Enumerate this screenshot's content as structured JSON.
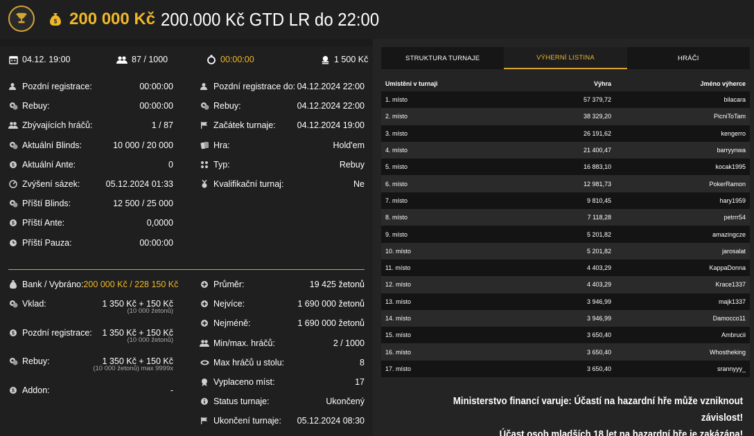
{
  "header": {
    "amount": "200 000 Kč",
    "title": "200.000 Kč GTD LR do 22:00"
  },
  "top_info": {
    "date": "04.12. 19:00",
    "players": "87 / 1000",
    "timer": "00:00:00",
    "buyin": "1 500 Kč"
  },
  "left_col": [
    {
      "icon": "user-clock-icon",
      "label": "Pozdní registrace:",
      "value": "00:00:00"
    },
    {
      "icon": "chips-icon",
      "label": "Rebuy:",
      "value": "00:00:00"
    },
    {
      "icon": "users-icon",
      "label": "Zbývajících hráčů:",
      "value": "1 / 87"
    },
    {
      "icon": "chips-icon",
      "label": "Aktuální Blinds:",
      "value": "10 000 / 20 000"
    },
    {
      "icon": "coin-icon",
      "label": "Aktuální Ante:",
      "value": "0"
    },
    {
      "icon": "gauge-icon",
      "label": "Zvýšení sázek:",
      "value": "05.12.2024 01:33"
    },
    {
      "icon": "chips-icon",
      "label": "Příští Blinds:",
      "value": "12 500 / 25 000"
    },
    {
      "icon": "coin-icon",
      "label": "Příští Ante:",
      "value": "0,0000"
    },
    {
      "icon": "clock-icon",
      "label": "Příští Pauza:",
      "value": "00:00:00"
    }
  ],
  "right_col": [
    {
      "icon": "user-clock-icon",
      "label": "Pozdní registrace do:",
      "value": "04.12.2024 22:00"
    },
    {
      "icon": "chips-icon",
      "label": "Rebuy:",
      "value": "04.12.2024 22:00"
    },
    {
      "icon": "flag-icon",
      "label": "Začátek turnaje:",
      "value": "04.12.2024 19:00"
    },
    {
      "icon": "cards-icon",
      "label": "Hra:",
      "value": "Hold'em"
    },
    {
      "icon": "suits-icon",
      "label": "Typ:",
      "value": "Rebuy"
    },
    {
      "icon": "medal-icon",
      "label": "Kvalifikační turnaj:",
      "value": "Ne"
    }
  ],
  "bank": {
    "label": "Bank / Vybráno:",
    "value": "200 000 Kč / 228 150 Kč"
  },
  "lower_left": [
    {
      "icon": "chips-icon",
      "label": "Vklad:",
      "value": "1 350 Kč + 150 Kč",
      "sub": "(10 000 žetonů)"
    },
    {
      "icon": "coin-icon",
      "label": "Pozdní registrace:",
      "value": "1 350 Kč + 150 Kč",
      "sub": "(10 000 žetonů)"
    },
    {
      "icon": "chips-icon",
      "label": "Rebuy:",
      "value": "1 350 Kč + 150 Kč",
      "sub": "(10 000 žetonů) max 9999x"
    },
    {
      "icon": "coin-icon",
      "label": "Addon:",
      "value": "-",
      "sub": ""
    }
  ],
  "lower_right": [
    {
      "icon": "plus-circle-icon",
      "label": "Průměr:",
      "value": "19 425 žetonů"
    },
    {
      "icon": "plus-circle-icon",
      "label": "Nejvíce:",
      "value": "1 690 000 žetonů"
    },
    {
      "icon": "plus-circle-icon",
      "label": "Nejméně:",
      "value": "1 690 000 žetonů"
    },
    {
      "icon": "users-icon",
      "label": "Min/max. hráčů:",
      "value": "2 / 1000"
    },
    {
      "icon": "table-icon",
      "label": "Max hráčů u stolu:",
      "value": "8"
    },
    {
      "icon": "award-icon",
      "label": "Vyplaceno míst:",
      "value": "17"
    },
    {
      "icon": "info-icon",
      "label": "Status turnaje:",
      "value": "Ukončený"
    },
    {
      "icon": "flag-icon",
      "label": "Ukončení turnaje:",
      "value": "05.12.2024 08:30"
    }
  ],
  "tabs": [
    {
      "label": "STRUKTURA TURNAJE",
      "active": false
    },
    {
      "label": "VÝHERNÍ LISTINA",
      "active": true
    },
    {
      "label": "HRÁČI",
      "active": false
    }
  ],
  "prize_table": {
    "headers": [
      "Umístění v turnaji",
      "Výhra",
      "Jméno výherce"
    ],
    "rows": [
      [
        "1. místo",
        "57 379,72",
        "bilacara"
      ],
      [
        "2. místo",
        "38 329,20",
        "PicniToTam"
      ],
      [
        "3. místo",
        "26 191,62",
        "kengerro"
      ],
      [
        "4. místo",
        "21 400,47",
        "barryynwa"
      ],
      [
        "5. místo",
        "16 883,10",
        "kocak1995"
      ],
      [
        "6. místo",
        "12 981,73",
        "PokerRamon"
      ],
      [
        "7. místo",
        "9 810,45",
        "hary1959"
      ],
      [
        "8. místo",
        "7 118,28",
        "petrrr54"
      ],
      [
        "9. místo",
        "5 201,82",
        "amazingcze"
      ],
      [
        "10. místo",
        "5 201,82",
        "jarosalat"
      ],
      [
        "11. místo",
        "4 403,29",
        "KappaDonna"
      ],
      [
        "12. místo",
        "4 403,29",
        "Krace1337"
      ],
      [
        "13. místo",
        "3 946,99",
        "majk1337"
      ],
      [
        "14. místo",
        "3 946,99",
        "Damocco11"
      ],
      [
        "15. místo",
        "3 650,40",
        "Ambrucii"
      ],
      [
        "16. místo",
        "3 650,40",
        "Whostheking"
      ],
      [
        "17. místo",
        "3 650,40",
        "srannyyy_"
      ]
    ]
  },
  "warning": {
    "line1": "Ministerstvo financí varuje: Účastí na hazardní hře může vzniknout závislost!",
    "line2": "Účast osob mladších 18 let na hazardní hře je zakázána!"
  },
  "colors": {
    "accent": "#f0b829",
    "background": "#1b1b1b",
    "panel": "#1f1f1f"
  }
}
